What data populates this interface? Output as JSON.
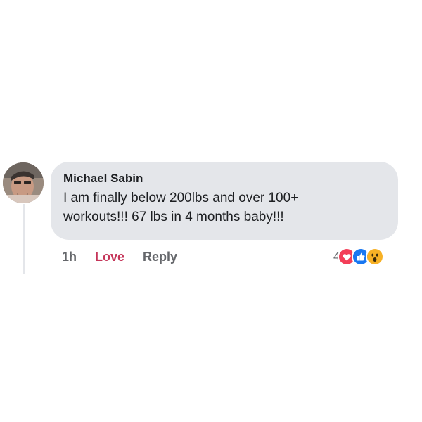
{
  "comment": {
    "author": "Michael Sabin",
    "text": "I am finally below 200lbs and over 100+\nworkouts!!! 67 lbs in 4 months baby!!!",
    "time": "1h",
    "love_label": "Love",
    "reply_label": "Reply",
    "reaction_count": "4",
    "reactions": [
      "love-icon",
      "like-icon",
      "wow-icon"
    ]
  },
  "colors": {
    "bubble": "#e4e6ea",
    "love": "#c53559",
    "muted": "#65676b",
    "like": "#1877f2",
    "heart": "#f33e58",
    "wow": "#f7b125"
  }
}
